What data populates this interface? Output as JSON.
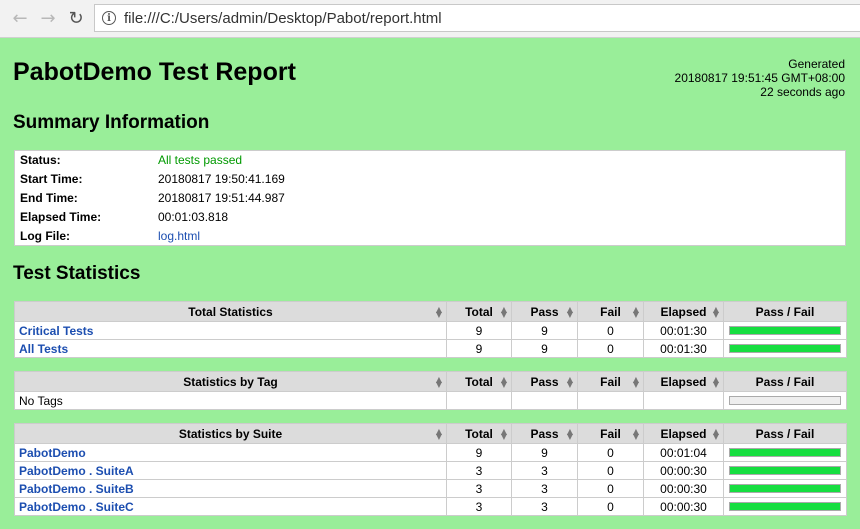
{
  "browser": {
    "url": "file:///C:/Users/admin/Desktop/Pabot/report.html"
  },
  "report": {
    "title": "PabotDemo Test Report",
    "generated_label": "Generated",
    "generated_time": "20180817 19:51:45 GMT+08:00",
    "generated_ago": "22 seconds ago"
  },
  "summary": {
    "heading": "Summary Information",
    "rows": [
      {
        "key": "Status:",
        "value": "All tests passed"
      },
      {
        "key": "Start Time:",
        "value": "20180817 19:50:41.169"
      },
      {
        "key": "End Time:",
        "value": "20180817 19:51:44.987"
      },
      {
        "key": "Elapsed Time:",
        "value": "00:01:03.818"
      },
      {
        "key": "Log File:",
        "value": "log.html"
      }
    ]
  },
  "statistics": {
    "heading": "Test Statistics",
    "columns": [
      "Total",
      "Pass",
      "Fail",
      "Elapsed",
      "Pass / Fail"
    ],
    "total": {
      "header": "Total Statistics",
      "rows": [
        {
          "name": "Critical Tests",
          "total": "9",
          "pass": "9",
          "fail": "0",
          "elapsed": "00:01:30",
          "pass_ratio": 1
        },
        {
          "name": "All Tests",
          "total": "9",
          "pass": "9",
          "fail": "0",
          "elapsed": "00:01:30",
          "pass_ratio": 1
        }
      ]
    },
    "tag": {
      "header": "Statistics by Tag",
      "rows": [
        {
          "name": "No Tags",
          "total": "",
          "pass": "",
          "fail": "",
          "elapsed": "",
          "pass_ratio": 0
        }
      ]
    },
    "suite": {
      "header": "Statistics by Suite",
      "rows": [
        {
          "name": "PabotDemo",
          "total": "9",
          "pass": "9",
          "fail": "0",
          "elapsed": "00:01:04",
          "pass_ratio": 1
        },
        {
          "name": "PabotDemo . SuiteA",
          "total": "3",
          "pass": "3",
          "fail": "0",
          "elapsed": "00:00:30",
          "pass_ratio": 1
        },
        {
          "name": "PabotDemo . SuiteB",
          "total": "3",
          "pass": "3",
          "fail": "0",
          "elapsed": "00:00:30",
          "pass_ratio": 1
        },
        {
          "name": "PabotDemo . SuiteC",
          "total": "3",
          "pass": "3",
          "fail": "0",
          "elapsed": "00:00:30",
          "pass_ratio": 1
        }
      ]
    }
  }
}
